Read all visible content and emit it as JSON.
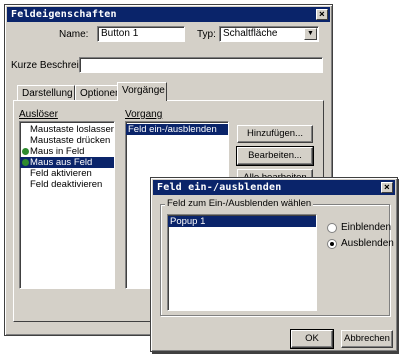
{
  "main_window": {
    "title": "Feldeigenschaften",
    "close_glyph": "×",
    "name_label": "Name:",
    "name_value": "Button 1",
    "type_label": "Typ:",
    "type_value": "Schaltfläche",
    "desc_label": "Kurze Beschreibung:",
    "desc_value": "",
    "tabs": [
      {
        "label": "Darstellung"
      },
      {
        "label": "Optionen"
      },
      {
        "label": "Vorgänge"
      }
    ],
    "trigger_label": "Auslöser",
    "triggers": [
      {
        "label": "Maustaste loslassen",
        "has_action": false,
        "selected": false
      },
      {
        "label": "Maustaste drücken",
        "has_action": false,
        "selected": false
      },
      {
        "label": "Maus in Feld",
        "has_action": true,
        "selected": false
      },
      {
        "label": "Maus aus Feld",
        "has_action": true,
        "selected": true
      },
      {
        "label": "Feld aktivieren",
        "has_action": false,
        "selected": false
      },
      {
        "label": "Feld deaktivieren",
        "has_action": false,
        "selected": false
      }
    ],
    "action_label": "Vorgang",
    "actions": [
      {
        "label": "Feld ein-/ausblenden",
        "selected": true
      }
    ],
    "buttons": {
      "add": "Hinzufügen...",
      "edit": "Bearbeiten...",
      "edit_all": "Alle bearbeiten"
    }
  },
  "sub_dialog": {
    "title": "Feld ein-/ausblenden",
    "close_glyph": "×",
    "group_label": "Feld zum Ein-/Ausblenden wählen",
    "fields": [
      {
        "label": "Popup 1",
        "selected": true
      }
    ],
    "radios": [
      {
        "label": "Einblenden",
        "checked": false
      },
      {
        "label": "Ausblenden",
        "checked": true
      }
    ],
    "ok_label": "OK",
    "cancel_label": "Abbrechen"
  },
  "colors": {
    "titlebar": "#0a246a",
    "face": "#d4d0c8",
    "selection": "#0a246a",
    "action_dot": "#2e8b2e"
  }
}
